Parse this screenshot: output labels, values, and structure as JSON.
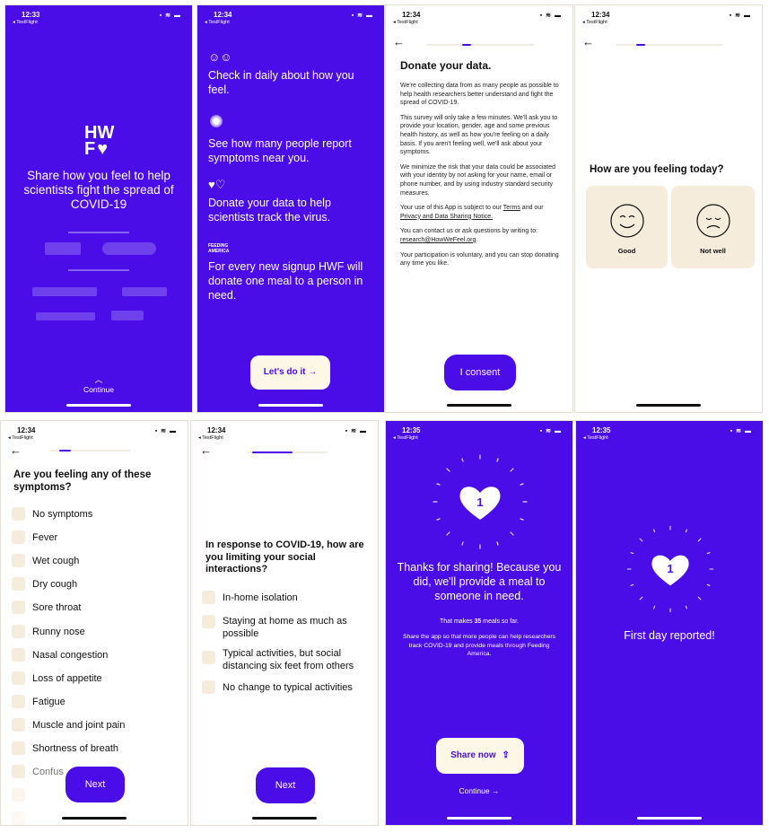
{
  "status": {
    "s1_time": "12:33",
    "s2_time": "12:34",
    "s3_time": "12:34",
    "s4_time": "12:34",
    "s5_time": "12:34",
    "s6_time": "12:34",
    "s7_time": "12:35",
    "s8_time": "12:35",
    "testflight": "◂ TestFlight"
  },
  "s1": {
    "logo_line1": "HW",
    "logo_line2": "F",
    "headline": "Share how you feel to help scientists fight the spread of COVID-19",
    "continue": "Continue"
  },
  "s2": {
    "items": [
      "Check in daily about how you feel.",
      "See how many people report symptoms near you.",
      "Donate your data to help scientists track the virus.",
      "For every new signup HWF will donate one meal to a person in need."
    ],
    "feeding_label": "FEEDING AMERICA",
    "cta": "Let's do it →"
  },
  "s3": {
    "title": "Donate your data.",
    "p1": "We're collecting data from as many people as possible to help health researchers better understand and fight the spread of COVID-19.",
    "p2": "This survey will only take a few minutes. We'll ask you to provide your location, gender, age and some previous health history, as well as how you're feeling on a daily basis. If you aren't feeling well, we'll ask about your symptoms.",
    "p3": "We minimize the risk that your data could be associated with your identity by not asking for your name, email or phone number, and by using industry standard security measures.",
    "p4a": "Your use of this App is subject to our ",
    "p4_terms": "Terms",
    "p4b": " and our ",
    "p4_privacy": "Privacy and Data Sharing Notice.",
    "p5a": "You can contact us or ask questions by writing to: ",
    "p5_email": "research@HowWeFeel.org",
    "p5b": ".",
    "p6": "Your participation is voluntary, and you can stop donating any time you like.",
    "consent": "I consent"
  },
  "s4": {
    "question": "How are you feeling today?",
    "good": "Good",
    "not_well": "Not well"
  },
  "s5": {
    "question": "Are you feeling any of these symptoms?",
    "symptoms": [
      "No symptoms",
      "Fever",
      "Wet cough",
      "Dry cough",
      "Sore throat",
      "Runny nose",
      "Nasal congestion",
      "Loss of appetite",
      "Fatigue",
      "Muscle and joint pain",
      "Shortness of breath",
      "Confus"
    ],
    "next": "Next"
  },
  "s6": {
    "question": "In response to COVID-19, how are you limiting your social interactions?",
    "options": [
      "In-home isolation",
      "Staying at home as much as possible",
      "Typical activities, but social distancing six feet from others",
      "No change to typical activities"
    ],
    "next": "Next"
  },
  "s7": {
    "count": "1",
    "thanks": "Thanks for sharing! Because you did, we'll provide a meal to someone in need.",
    "meals_a": "That makes ",
    "meals_n": "35",
    "meals_b": " meals so far.",
    "share_text": "Share the app so that more people can help researchers track COVID-19 and provide meals through Feeding America.",
    "share_btn": "Share now",
    "continue": "Continue →"
  },
  "s8": {
    "count": "1",
    "message": "First day reported!"
  },
  "colors": {
    "purple": "#4a0de8",
    "cream": "#fdf7e8",
    "card": "#f6ecdc"
  }
}
